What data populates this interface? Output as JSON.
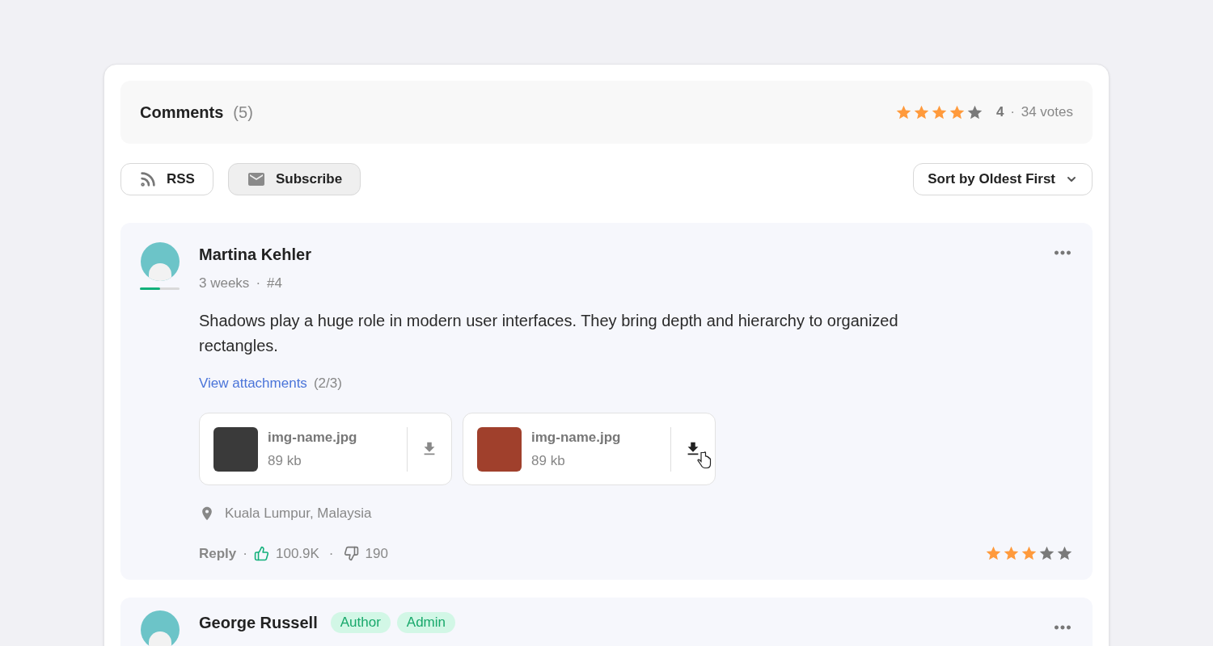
{
  "header": {
    "title": "Comments",
    "count": "(5)",
    "rating": {
      "stars": 4,
      "score": "4",
      "separator": "·",
      "votes": "34 votes"
    }
  },
  "actions": [
    {
      "label": "RSS",
      "kind": "rss",
      "active": false
    },
    {
      "label": "Subscribe",
      "kind": "mail",
      "active": true
    }
  ],
  "sort": {
    "label": "Sort by Oldest First"
  },
  "comments": [
    {
      "author": "Martina Kehler",
      "level": 0.5,
      "time": "3 weeks",
      "meta_separator": "·",
      "number": "#4",
      "body": "Shadows play a huge role in modern user interfaces. They bring depth and hierarchy to organized rectangles.",
      "attachments_link": "View attachments",
      "attachments_count": "(2/3)",
      "attachments": [
        {
          "name": "img-name.jpg",
          "size": "89 kb",
          "hovered": false
        },
        {
          "name": "img-name.jpg",
          "size": "89 kb",
          "hovered": true
        }
      ],
      "location": "Kuala Lumpur, Malaysia",
      "reply": "Reply",
      "reply_separator": "·",
      "likes_separator": "·",
      "likes": "100.9K",
      "dislikes": "190",
      "stars": 3
    },
    {
      "author": "George Russell",
      "badges": [
        "Author",
        "Admin"
      ]
    }
  ]
}
